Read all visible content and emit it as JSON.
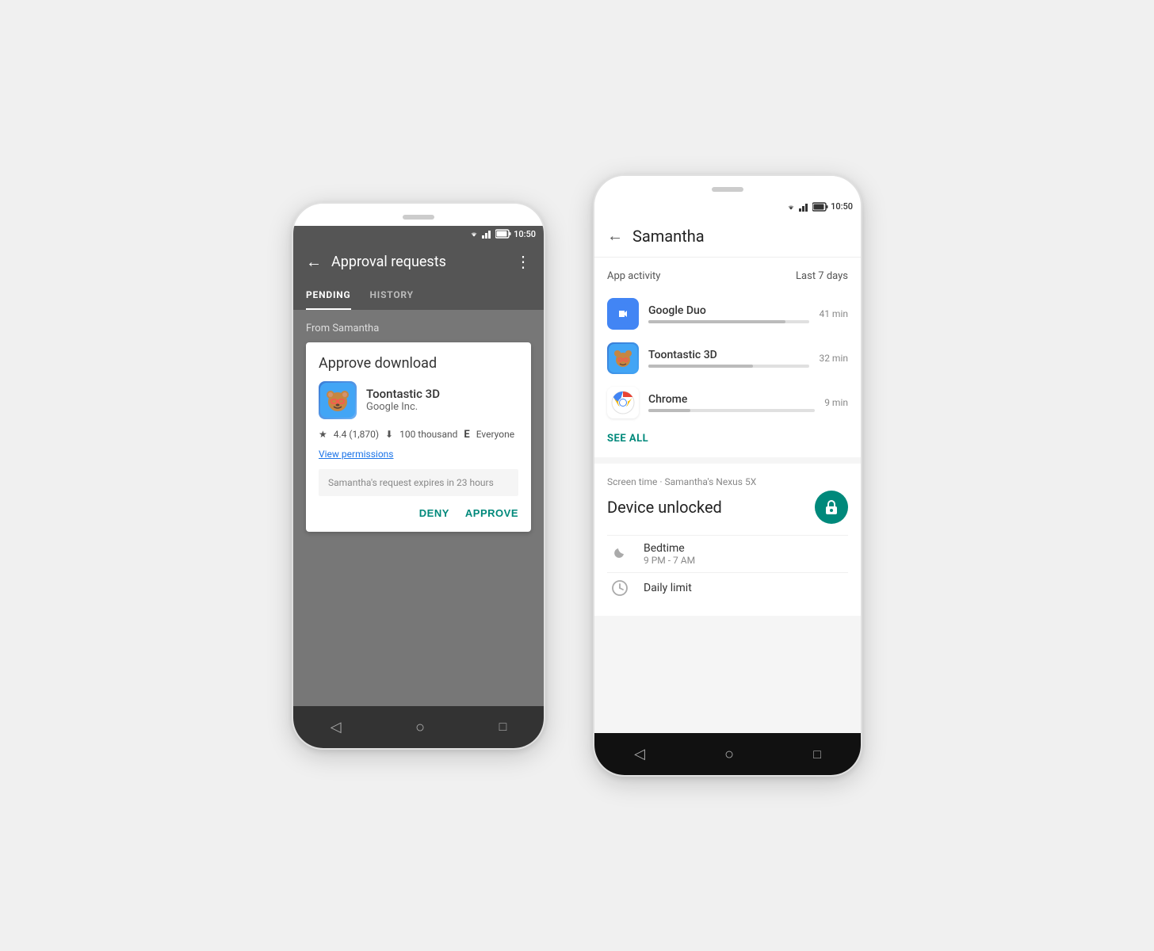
{
  "phone1": {
    "statusbar": {
      "time": "10:50"
    },
    "header": {
      "back": "←",
      "title": "Approval requests",
      "more": "⋮"
    },
    "tabs": [
      {
        "label": "PENDING",
        "active": true
      },
      {
        "label": "HISTORY",
        "active": false
      }
    ],
    "from_label": "From Samantha",
    "card": {
      "title": "Approve download",
      "app_name": "Toontastic 3D",
      "app_dev": "Google Inc.",
      "rating": "4.4 (1,870)",
      "downloads": "100 thousand",
      "audience": "Everyone",
      "view_permissions": "View permissions",
      "expiry": "Samantha's request expires in 23 hours",
      "deny": "DENY",
      "approve": "APPROVE"
    },
    "nav": {
      "back": "◁",
      "home": "○",
      "square": "□"
    }
  },
  "phone2": {
    "statusbar": {
      "time": "10:50"
    },
    "header": {
      "back": "←",
      "title": "Samantha"
    },
    "app_activity": {
      "label": "App activity",
      "period": "Last 7 days",
      "apps": [
        {
          "name": "Google Duo",
          "time": "41 min",
          "progress": 85
        },
        {
          "name": "Toontastic 3D",
          "time": "32 min",
          "progress": 65
        },
        {
          "name": "Chrome",
          "time": "9 min",
          "progress": 25
        }
      ],
      "see_all": "SEE ALL"
    },
    "device": {
      "subtitle": "Screen time · Samantha's Nexus 5X",
      "title": "Device unlocked",
      "features": [
        {
          "icon": "moon",
          "name": "Bedtime",
          "value": "9 PM - 7 AM"
        },
        {
          "icon": "clock",
          "name": "Daily limit",
          "value": ""
        }
      ]
    },
    "nav": {
      "back": "◁",
      "home": "○",
      "square": "□"
    }
  }
}
